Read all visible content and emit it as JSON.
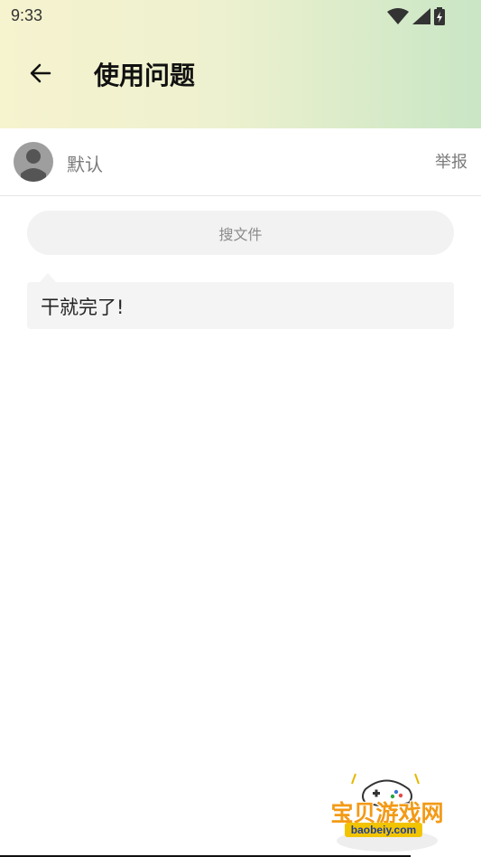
{
  "status_bar": {
    "time": "9:33",
    "icons": [
      "wifi-icon",
      "signal-icon",
      "battery-icon"
    ]
  },
  "header": {
    "title": "使用问题",
    "back_icon": "arrow-left-icon"
  },
  "post": {
    "username": "默认",
    "report_label": "举报",
    "file_button_label": "搜文件",
    "message": "干就完了!"
  },
  "watermark": {
    "title": "宝贝游戏网",
    "url": "baobeiy.com"
  },
  "colors": {
    "header_gradient_start": "#f6f3cf",
    "header_gradient_end": "#c9e6c5",
    "bubble_bg": "#f4f4f4",
    "watermark_orange": "#f39a16"
  }
}
